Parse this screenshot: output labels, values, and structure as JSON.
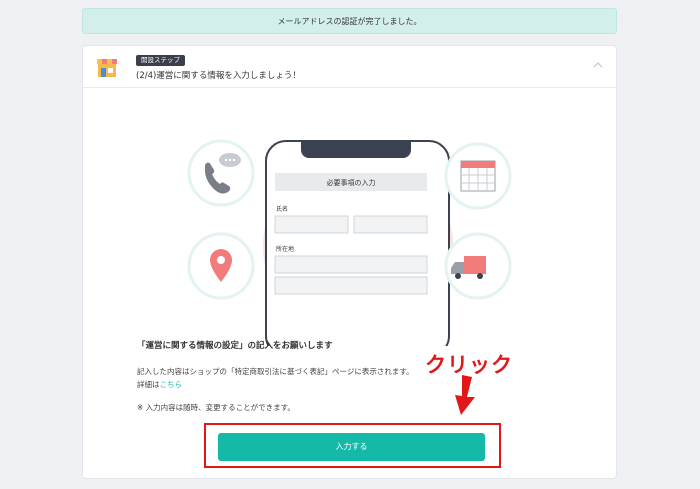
{
  "notice": {
    "text": "メールアドレスの認証が完了しました。"
  },
  "header": {
    "badge": "開設ステップ",
    "title": "(2/4)運営に関する情報を入力しましょう！"
  },
  "phone_form": {
    "title": "必要事項の入力",
    "name_label": "氏名",
    "address_label": "所在地"
  },
  "content": {
    "heading": "「運営に関する情報の設定」の記入をお願いします",
    "line1": "記入した内容はショップの「特定商取引法に基づく表記」ページに表示されます。",
    "line2_prefix": "詳細は",
    "line2_link": "こちら",
    "note": "※ 入力内容は随時、変更することができます。"
  },
  "button": {
    "label": "入力する"
  },
  "annotation": {
    "label": "クリック"
  },
  "colors": {
    "accent": "#14b9a8",
    "annotation": "#e21818",
    "notice_bg": "#d3efec"
  },
  "icons": [
    "shop-icon",
    "chevron-up-icon",
    "phone-chat-icon",
    "calendar-icon",
    "location-pin-icon",
    "truck-icon",
    "down-arrow-icon"
  ]
}
